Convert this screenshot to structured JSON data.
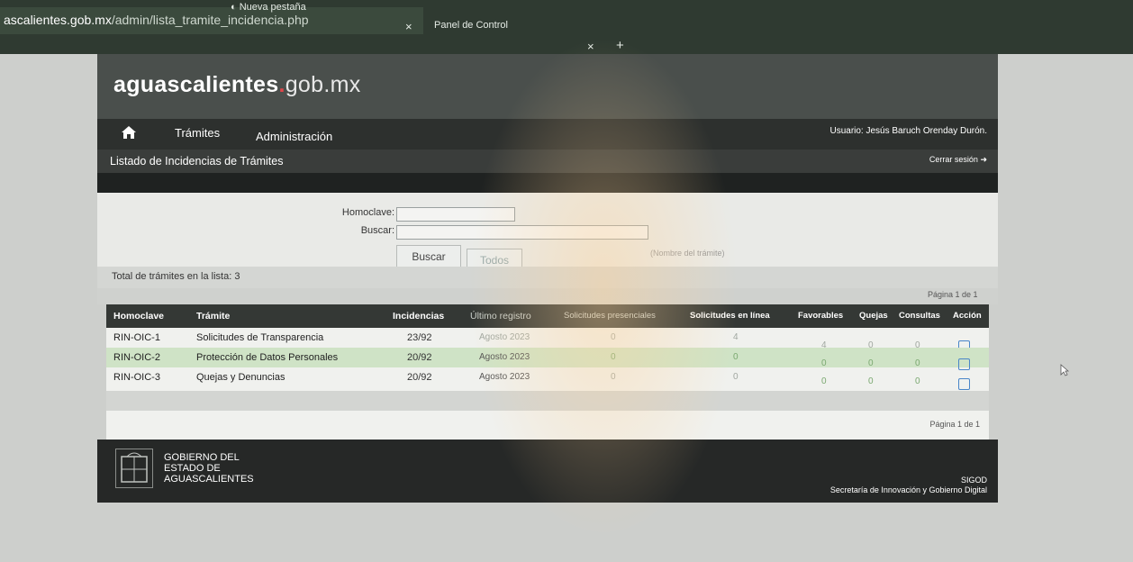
{
  "browser": {
    "url_host": "ascalientes.gob.mx",
    "url_path": "/admin/lista_tramite_incidencia.php",
    "tabs": [
      {
        "label": "Nueva pestaña"
      },
      {
        "label": "Panel de Control"
      }
    ],
    "close_glyph": "×",
    "new_tab_glyph": "+"
  },
  "site": {
    "logo_main": "aguascalientes",
    "logo_dot": ".",
    "logo_suffix": "gob.mx",
    "nav": [
      "Trámites",
      "Administración"
    ],
    "home_icon": "home-icon",
    "user": "Usuario: Jesús Baruch Orenday Durón.",
    "logout": "Cerrar sesión"
  },
  "page": {
    "title": "Listado de Incidencias de Trámites",
    "search": {
      "homoclave_label": "Homoclave:",
      "buscar_label": "Buscar:",
      "hint": "(Nombre del trámite)",
      "buscar_button": "Buscar",
      "todos_button": "Todos"
    },
    "total_label": "Total de trámites en la lista: 3",
    "pagination_top": "Página 1 de 1",
    "pagination_bottom": "Página 1 de 1"
  },
  "table": {
    "headers": [
      "Homoclave",
      "Trámite",
      "Incidencias",
      "Último registro",
      "Solicitudes presenciales",
      "Solicitudes en línea",
      "Favorables",
      "Quejas",
      "Consultas",
      "Acción"
    ],
    "rows": [
      {
        "homoclave": "RIN-OIC-1",
        "tramite": "Solicitudes de Transparencia",
        "incidencias": "23/92",
        "ultimo": "Agosto 2023",
        "presenciales": "0",
        "en_linea": "4",
        "favorables": "4",
        "quejas": "0",
        "consultas": "0"
      },
      {
        "homoclave": "RIN-OIC-2",
        "tramite": "Protección de Datos Personales",
        "incidencias": "20/92",
        "ultimo": "Agosto 2023",
        "presenciales": "0",
        "en_linea": "0",
        "favorables": "0",
        "quejas": "0",
        "consultas": "0"
      },
      {
        "homoclave": "RIN-OIC-3",
        "tramite": "Quejas y Denuncias",
        "incidencias": "20/92",
        "ultimo": "Agosto 2023",
        "presenciales": "0",
        "en_linea": "0",
        "favorables": "0",
        "quejas": "0",
        "consultas": "0"
      }
    ]
  },
  "footer": {
    "gov_line1": "GOBIERNO DEL",
    "gov_line2": "ESTADO DE",
    "gov_line3": "AGUASCALIENTES",
    "sigod": "SIGOD",
    "secretaria": "Secretaría de Innovación y Gobierno Digital"
  },
  "colors": {
    "accent_red": "#e0464a",
    "row_alt": "#cfe3c6",
    "header_dark": "#343835"
  }
}
